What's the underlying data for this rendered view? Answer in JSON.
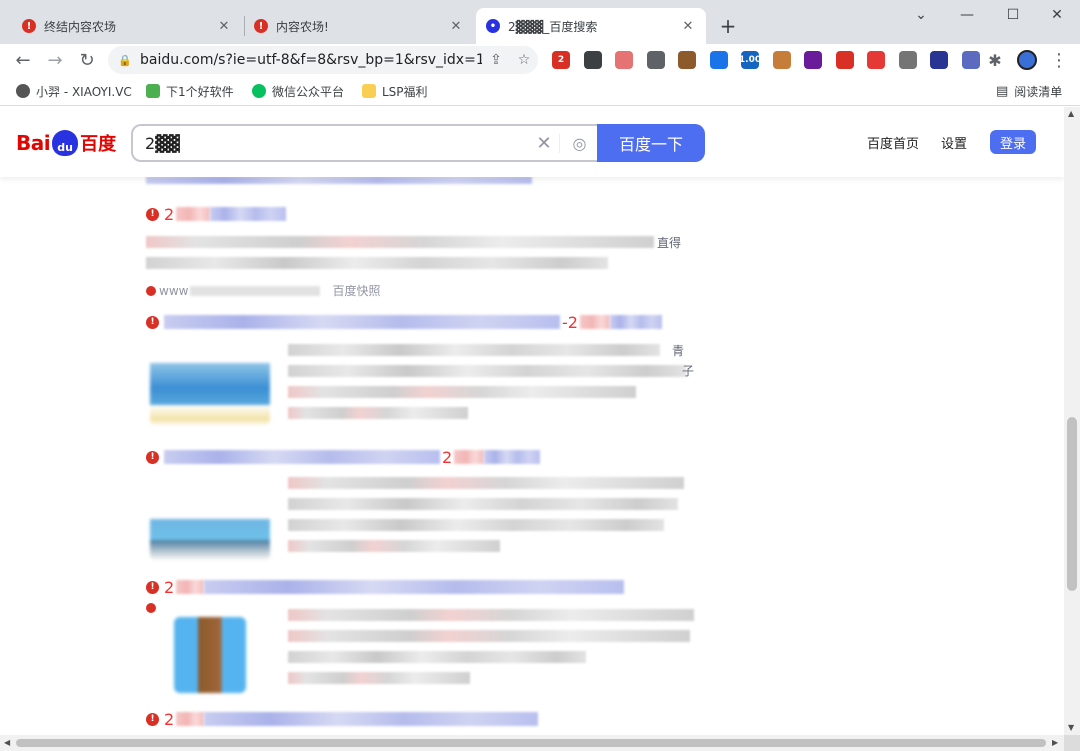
{
  "tabs": [
    {
      "title": "终结内容农场",
      "icon": "!"
    },
    {
      "title": "内容农场!",
      "icon": "!"
    },
    {
      "title": "2▓▓▓_百度搜索",
      "icon": "🐾"
    }
  ],
  "window_controls": {
    "minimize": "—",
    "restore": "☐",
    "close": "✕"
  },
  "new_tab": "+",
  "address": {
    "url": "baidu.com/s?ie=utf-8&f=8&rsv_bp=1&rsv_idx=1..."
  },
  "extensions": [
    {
      "name": "opera-ext",
      "badge": "2",
      "color": "#d93025"
    },
    {
      "name": "dots-ext",
      "badge": "",
      "color": "#3c4043"
    },
    {
      "name": "pen-ext",
      "badge": "",
      "color": "#e57373"
    },
    {
      "name": "copy-ext",
      "badge": "",
      "color": "#5f6368"
    },
    {
      "name": "cookie-ext",
      "badge": "",
      "color": "#8d5a2b"
    },
    {
      "name": "image-ext",
      "badge": "",
      "color": "#1a73e8"
    },
    {
      "name": "tv-ext",
      "badge": "1.00",
      "color": "#1565c0"
    },
    {
      "name": "monkey-ext",
      "badge": "",
      "color": "#c77d3a"
    },
    {
      "name": "mask-ext",
      "badge": "",
      "color": "#6a1b9a"
    },
    {
      "name": "alert-ext",
      "badge": "",
      "color": "#d93025"
    },
    {
      "name": "block-ext",
      "badge": "",
      "color": "#e53935"
    },
    {
      "name": "arrow-ext",
      "badge": "",
      "color": "#757575"
    },
    {
      "name": "store-ext",
      "badge": "",
      "color": "#283593"
    },
    {
      "name": "at-ext",
      "badge": "",
      "color": "#5c6bc0"
    }
  ],
  "bookmarks": [
    {
      "label": "小羿 - XIAOYI.VC",
      "color": "#555"
    },
    {
      "label": "下1个好软件",
      "color": "#4caf50"
    },
    {
      "label": "微信公众平台",
      "color": "#07c160"
    },
    {
      "label": "LSP福利",
      "color": "#f9ce52"
    }
  ],
  "reading_list": "阅读清单",
  "baidu": {
    "logo_left": "Bai",
    "logo_paw": "du",
    "logo_right": "百度",
    "query": "2▓▓",
    "search_button": "百度一下",
    "home_link": "百度首页",
    "settings_link": "设置",
    "login_button": "登录"
  },
  "results": [
    {
      "num": "2",
      "trail": "直得",
      "source": "www",
      "cache": "百度快照"
    },
    {
      "num": "",
      "suffix": "-2",
      "trail1": "青",
      "trail2": "子"
    },
    {
      "num": "",
      "suffix": "2"
    },
    {
      "num": "2"
    },
    {
      "num": "2"
    }
  ]
}
